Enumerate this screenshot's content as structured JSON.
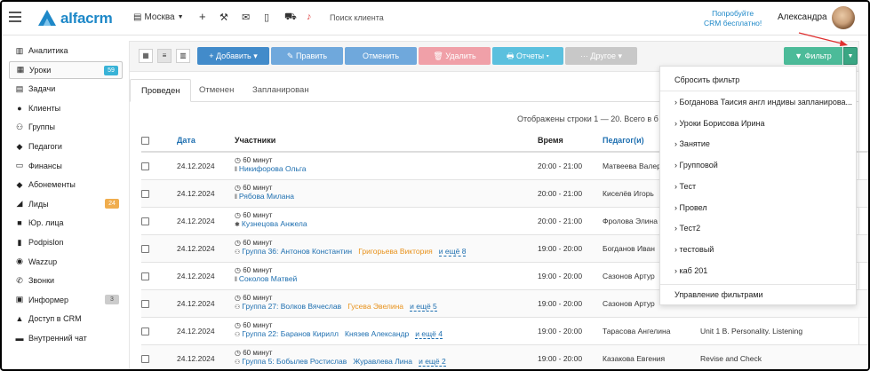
{
  "app": {
    "name": "alfacrm"
  },
  "header": {
    "branch": "Москва",
    "search_placeholder": "Поиск клиента",
    "promo_line1": "Попробуйте",
    "promo_line2": "CRM бесплатно!",
    "username": "Александра"
  },
  "sidebar": {
    "items": [
      {
        "label": "Аналитика",
        "icon": "chart-icon"
      },
      {
        "label": "Уроки",
        "icon": "calendar-icon",
        "badge": "59",
        "badge_color": "#39b3d7",
        "active": true
      },
      {
        "label": "Задачи",
        "icon": "task-icon"
      },
      {
        "label": "Клиенты",
        "icon": "user-icon"
      },
      {
        "label": "Группы",
        "icon": "users-icon"
      },
      {
        "label": "Педагоги",
        "icon": "graduation-icon"
      },
      {
        "label": "Финансы",
        "icon": "money-icon"
      },
      {
        "label": "Абонементы",
        "icon": "tag-icon"
      },
      {
        "label": "Лиды",
        "icon": "lead-icon",
        "badge": "24",
        "badge_color": "#f0ad4e"
      },
      {
        "label": "Юр. лица",
        "icon": "briefcase-icon"
      },
      {
        "label": "Podpislon",
        "icon": "document-icon"
      },
      {
        "label": "Wazzup",
        "icon": "whatsapp-icon"
      },
      {
        "label": "Звонки",
        "icon": "phone-icon"
      },
      {
        "label": "Информер",
        "icon": "bell-icon",
        "badge": "3",
        "badge_color": "#cccccc"
      },
      {
        "label": "Доступ в CRM",
        "icon": "lock-icon"
      },
      {
        "label": "Внутренний чат",
        "icon": "chat-icon"
      }
    ]
  },
  "toolbar": {
    "add_label": "+ Добавить ▾",
    "edit_label": "✎ Править",
    "cancel_label": "Отменить",
    "delete_label": "🗑 Удалить",
    "reports_label": "🖶 Отчеты ▾",
    "other_label": "··· Другое ▾",
    "filter_label": "▼ Фильтр",
    "colors": {
      "add": "#428bca",
      "edit": "#6fa8dc",
      "cancel": "#6fa8dc",
      "delete": "#f0a0a8",
      "reports": "#5bc0de",
      "other": "#c8c8c8",
      "filter": "#4cbb99"
    }
  },
  "tabs": [
    {
      "label": "Проведен",
      "active": true
    },
    {
      "label": "Отменен"
    },
    {
      "label": "Запланирован"
    }
  ],
  "rows_info": "Отображены строки 1 — 20. Всего в б",
  "table": {
    "headers": {
      "date": "Дата",
      "participants": "Участники",
      "time": "Время",
      "teacher": "Педагог(и)"
    },
    "rows": [
      {
        "date": "24.12.2024",
        "duration": "60 минут",
        "type": "individual",
        "participants": [
          {
            "name": "Никифорова Ольга",
            "color": "blue"
          }
        ],
        "more": "",
        "time": "20:00 - 21:00",
        "teacher": "Матвеева Валер",
        "topic": ""
      },
      {
        "date": "24.12.2024",
        "duration": "60 минут",
        "type": "individual",
        "participants": [
          {
            "name": "Рябова Милана",
            "color": "blue"
          }
        ],
        "more": "",
        "time": "20:00 - 21:00",
        "teacher": "Киселёв Игорь",
        "topic": ""
      },
      {
        "date": "24.12.2024",
        "duration": "60 минут",
        "type": "trial",
        "participants": [
          {
            "name": "Кузнецова Анжела",
            "color": "blue"
          }
        ],
        "more": "",
        "time": "20:00 - 21:00",
        "teacher": "Фролова Элина",
        "topic": ""
      },
      {
        "date": "24.12.2024",
        "duration": "60 минут",
        "type": "group",
        "participants": [
          {
            "name": "Группа 36: Антонов Константин",
            "color": "blue"
          },
          {
            "name": "Григорьева Виктория",
            "color": "orange"
          }
        ],
        "more": "и ещё 8",
        "time": "19:00 - 20:00",
        "teacher": "Богданов Иван",
        "topic": ""
      },
      {
        "date": "24.12.2024",
        "duration": "60 минут",
        "type": "individual",
        "participants": [
          {
            "name": "Соколов Матвей",
            "color": "blue"
          }
        ],
        "more": "",
        "time": "19:00 - 20:00",
        "teacher": "Сазонов Артур",
        "topic": ""
      },
      {
        "date": "24.12.2024",
        "duration": "60 минут",
        "type": "group",
        "participants": [
          {
            "name": "Группа 27: Волков Вячеслав",
            "color": "blue"
          },
          {
            "name": "Гусева Эвелина",
            "color": "orange"
          }
        ],
        "more": "и ещё 5",
        "time": "19:00 - 20:00",
        "teacher": "Сазонов Артур",
        "topic": ""
      },
      {
        "date": "24.12.2024",
        "duration": "60 минут",
        "type": "group",
        "participants": [
          {
            "name": "Группа 22: Баранов Кирилл",
            "color": "blue"
          },
          {
            "name": "Князев Александр",
            "color": "blue"
          }
        ],
        "more": "и ещё 4",
        "time": "19:00 - 20:00",
        "teacher": "Тарасова Ангелина",
        "topic": "Unit 1 B. Personality. Listening"
      },
      {
        "date": "24.12.2024",
        "duration": "60 минут",
        "type": "group",
        "participants": [
          {
            "name": "Группа 5: Бобылев Ростислав",
            "color": "blue"
          },
          {
            "name": "Журавлева Лина",
            "color": "blue"
          }
        ],
        "more": "и ещё 2",
        "time": "19:00 - 20:00",
        "teacher": "Казакова Евгения",
        "topic": "Revise and Check"
      }
    ]
  },
  "filter_dropdown": {
    "reset": "Сбросить фильтр",
    "items": [
      "› Богданова Таисия англ индивы запланирова...",
      "› Уроки Борисова Ирина",
      "› Занятие",
      "› Групповой",
      "› Тест",
      "› Провел",
      "› Тест2",
      "› тестовый",
      "› каб 201"
    ],
    "manage": "Управление фильтрами"
  }
}
